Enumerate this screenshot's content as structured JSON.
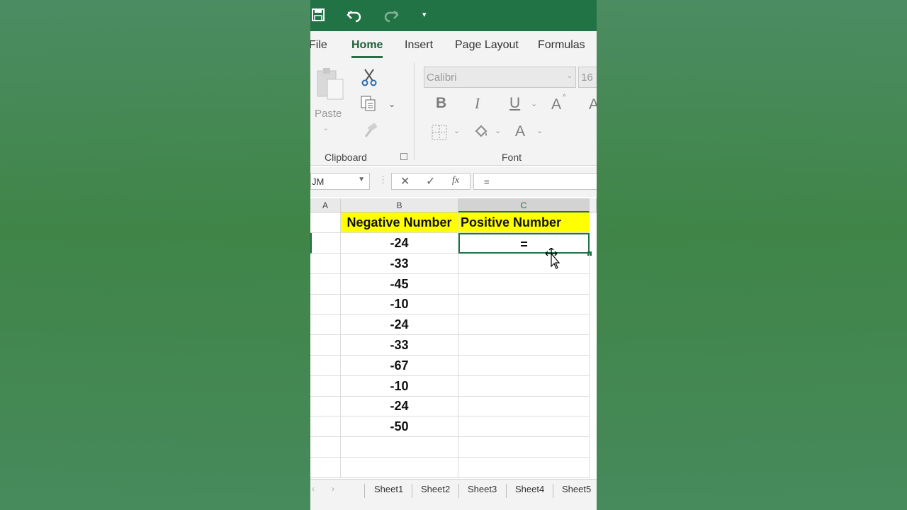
{
  "qat": {
    "save_icon": "save-icon",
    "undo_icon": "undo-icon",
    "redo_icon": "redo-icon",
    "customize_icon": "customize-qat-icon"
  },
  "tabs": [
    {
      "label": "File",
      "active": false
    },
    {
      "label": "Home",
      "active": true
    },
    {
      "label": "Insert",
      "active": false
    },
    {
      "label": "Page Layout",
      "active": false
    },
    {
      "label": "Formulas",
      "active": false
    }
  ],
  "ribbon": {
    "clipboard": {
      "paste_label": "Paste",
      "group_label": "Clipboard"
    },
    "font": {
      "font_name": "Calibri",
      "font_size": "16",
      "group_label": "Font",
      "bold": "B",
      "italic": "I",
      "underline": "U",
      "grow": "A",
      "color": "A"
    }
  },
  "formula_bar": {
    "name_box": "JM",
    "formula": "="
  },
  "sheet": {
    "columns": [
      "A",
      "B",
      "C"
    ],
    "selected_column": "C",
    "header_row": {
      "b": "Negative Number",
      "c": "Positive Number"
    },
    "rows": [
      {
        "b": "-24",
        "c": "="
      },
      {
        "b": "-33",
        "c": ""
      },
      {
        "b": "-45",
        "c": ""
      },
      {
        "b": "-10",
        "c": ""
      },
      {
        "b": "-24",
        "c": ""
      },
      {
        "b": "-33",
        "c": ""
      },
      {
        "b": "-67",
        "c": ""
      },
      {
        "b": "-10",
        "c": ""
      },
      {
        "b": "-24",
        "c": ""
      },
      {
        "b": "-50",
        "c": ""
      },
      {
        "b": "",
        "c": ""
      },
      {
        "b": "",
        "c": ""
      }
    ]
  },
  "sheet_tabs": [
    "Sheet1",
    "Sheet2",
    "Sheet3",
    "Sheet4",
    "Sheet5"
  ],
  "colors": {
    "excel_green": "#217346",
    "header_fill": "#ffff00"
  }
}
